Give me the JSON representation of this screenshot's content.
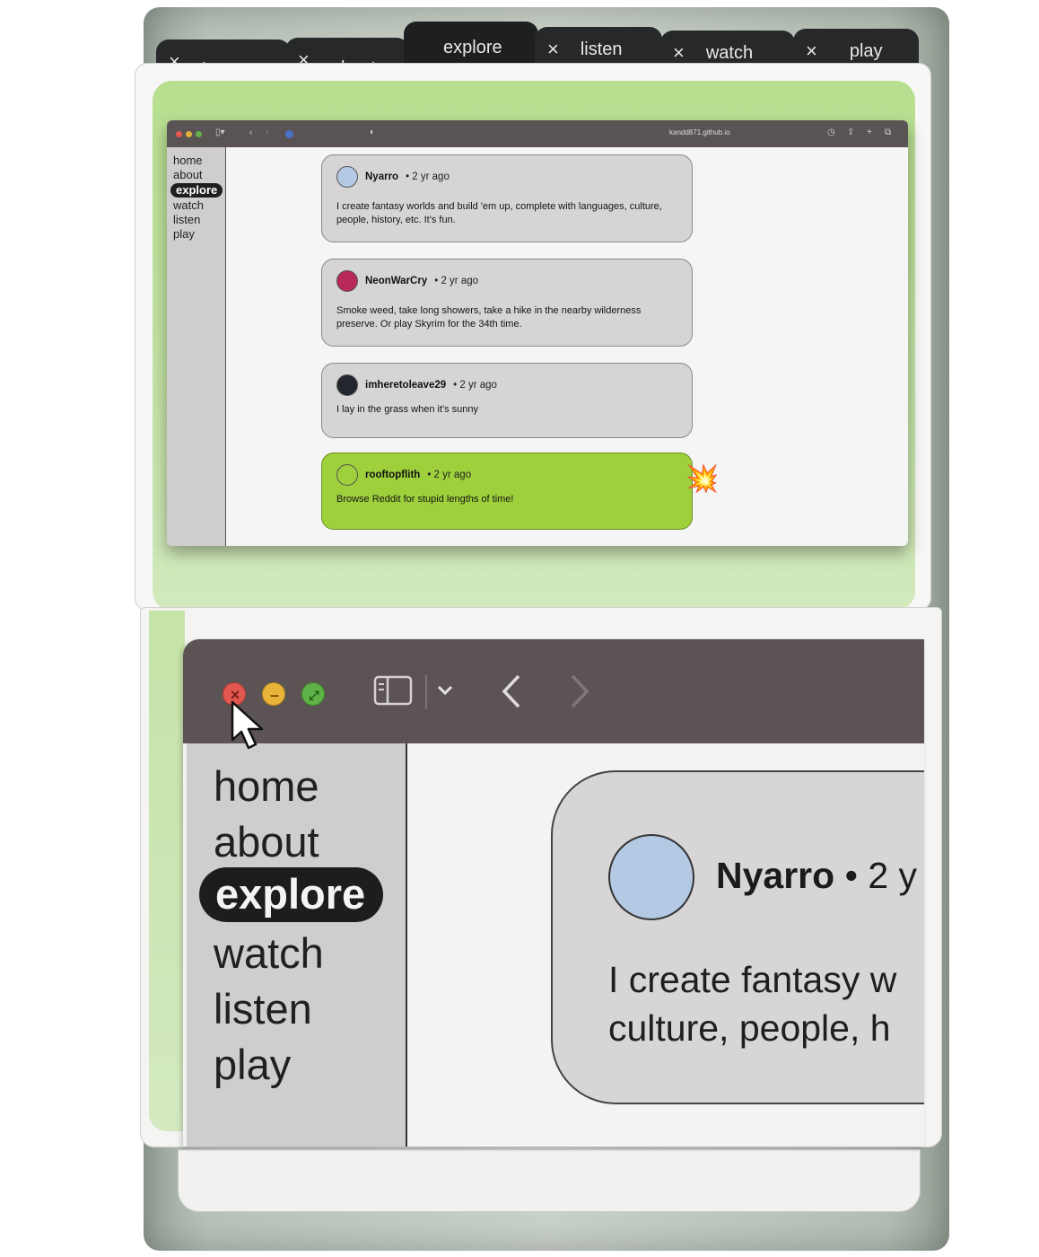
{
  "tabs": [
    {
      "label": "home",
      "close": "×"
    },
    {
      "label": "about",
      "close": "×"
    },
    {
      "label": "explore",
      "close": ""
    },
    {
      "label": "listen",
      "close": "×"
    },
    {
      "label": "watch",
      "close": "×"
    },
    {
      "label": "play",
      "close": "×"
    }
  ],
  "browser": {
    "url": "kandd871.github.io",
    "nav": [
      "home",
      "about",
      "explore",
      "watch",
      "listen",
      "play"
    ],
    "active_nav": "explore"
  },
  "posts": [
    {
      "user": "Nyarro",
      "time": "• 2 yr ago",
      "body": "I create fantasy worlds and build 'em up, complete with languages, culture, people, history, etc. It's fun.",
      "avatar_color": "#b4c9e4"
    },
    {
      "user": "NeonWarCry",
      "time": "• 2 yr ago",
      "body": "Smoke weed, take long showers, take a hike in the nearby wilderness preserve. Or play Skyrim for the 34th time.",
      "avatar_color": "#b8285a"
    },
    {
      "user": "imheretoleave29",
      "time": "• 2 yr ago",
      "body": "I lay in the grass when it's sunny",
      "avatar_color": "#23262d"
    },
    {
      "user": "rooftopflith",
      "time": "• 2 yr ago",
      "body": "Browse Reddit for stupid lengths of time!",
      "avatar_color": "#9ed03c"
    }
  ],
  "zoom": {
    "user": "Nyarro",
    "time": "• 2 y",
    "line1": "I create fantasy w",
    "line2": "culture, people, h"
  },
  "icons": {
    "boom": "💥",
    "close": "×",
    "minimize": "–",
    "fullscreen": "⤢"
  },
  "colors": {
    "accent_green": "#9ed03c",
    "toolbar": "#5b5354",
    "sidebar": "#cfcdcd"
  }
}
